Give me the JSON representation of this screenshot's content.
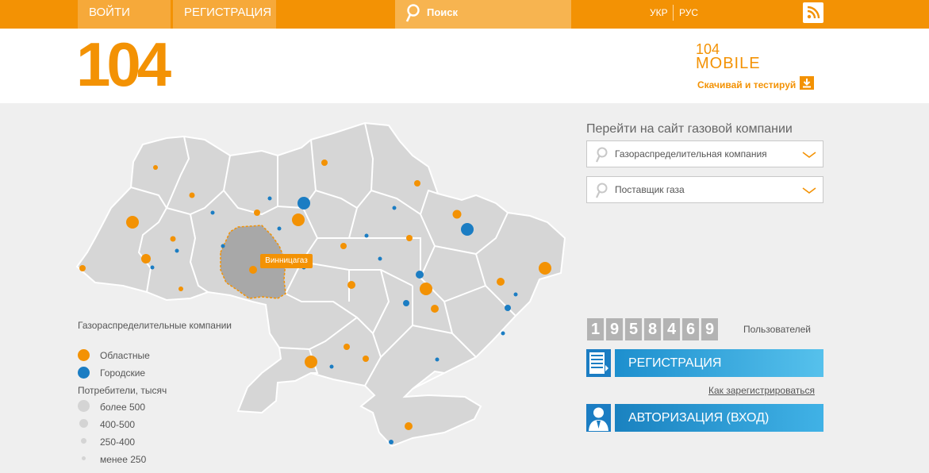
{
  "topbar": {
    "login_label": "ВОЙТИ",
    "register_label": "РЕГИСТРАЦИЯ",
    "search_placeholder": "Поиск",
    "lang_ukr": "УКР",
    "lang_rus": "РУС",
    "rss_icon": "rss-icon"
  },
  "header": {
    "logo": "104",
    "mobile_line1": "104",
    "mobile_line2": "MOBILE",
    "mobile_tagline": "Скачивай и тестируй",
    "download_icon": "download-icon"
  },
  "map": {
    "selected_region_label": "Винницагаз",
    "colors": {
      "region": "#d6d6d6",
      "region_border": "#ffffff",
      "selected": "#a8a8a8",
      "oblast": "#f39204",
      "city": "#1b7dc3"
    }
  },
  "legend": {
    "title": "Газораспределительные компании",
    "oblast_label": "Областные",
    "city_label": "Городские",
    "consumers_title": "Потребители, тысяч",
    "sizes": [
      "более 500",
      "400-500",
      "250-400",
      "менее 250"
    ]
  },
  "right": {
    "goto_title": "Перейти на сайт газовой компании",
    "select1_placeholder": "Газораспределительная компания",
    "select2_placeholder": "Поставщик газа",
    "counter_digits": [
      "1",
      "9",
      "5",
      "8",
      "4",
      "6",
      "9"
    ],
    "users_label": "Пользователей",
    "register_button": "РЕГИСТРАЦИЯ",
    "how_register_link": "Как зарегистрироваться",
    "auth_button": "АВТОРИЗАЦИЯ (ВХОД)"
  }
}
